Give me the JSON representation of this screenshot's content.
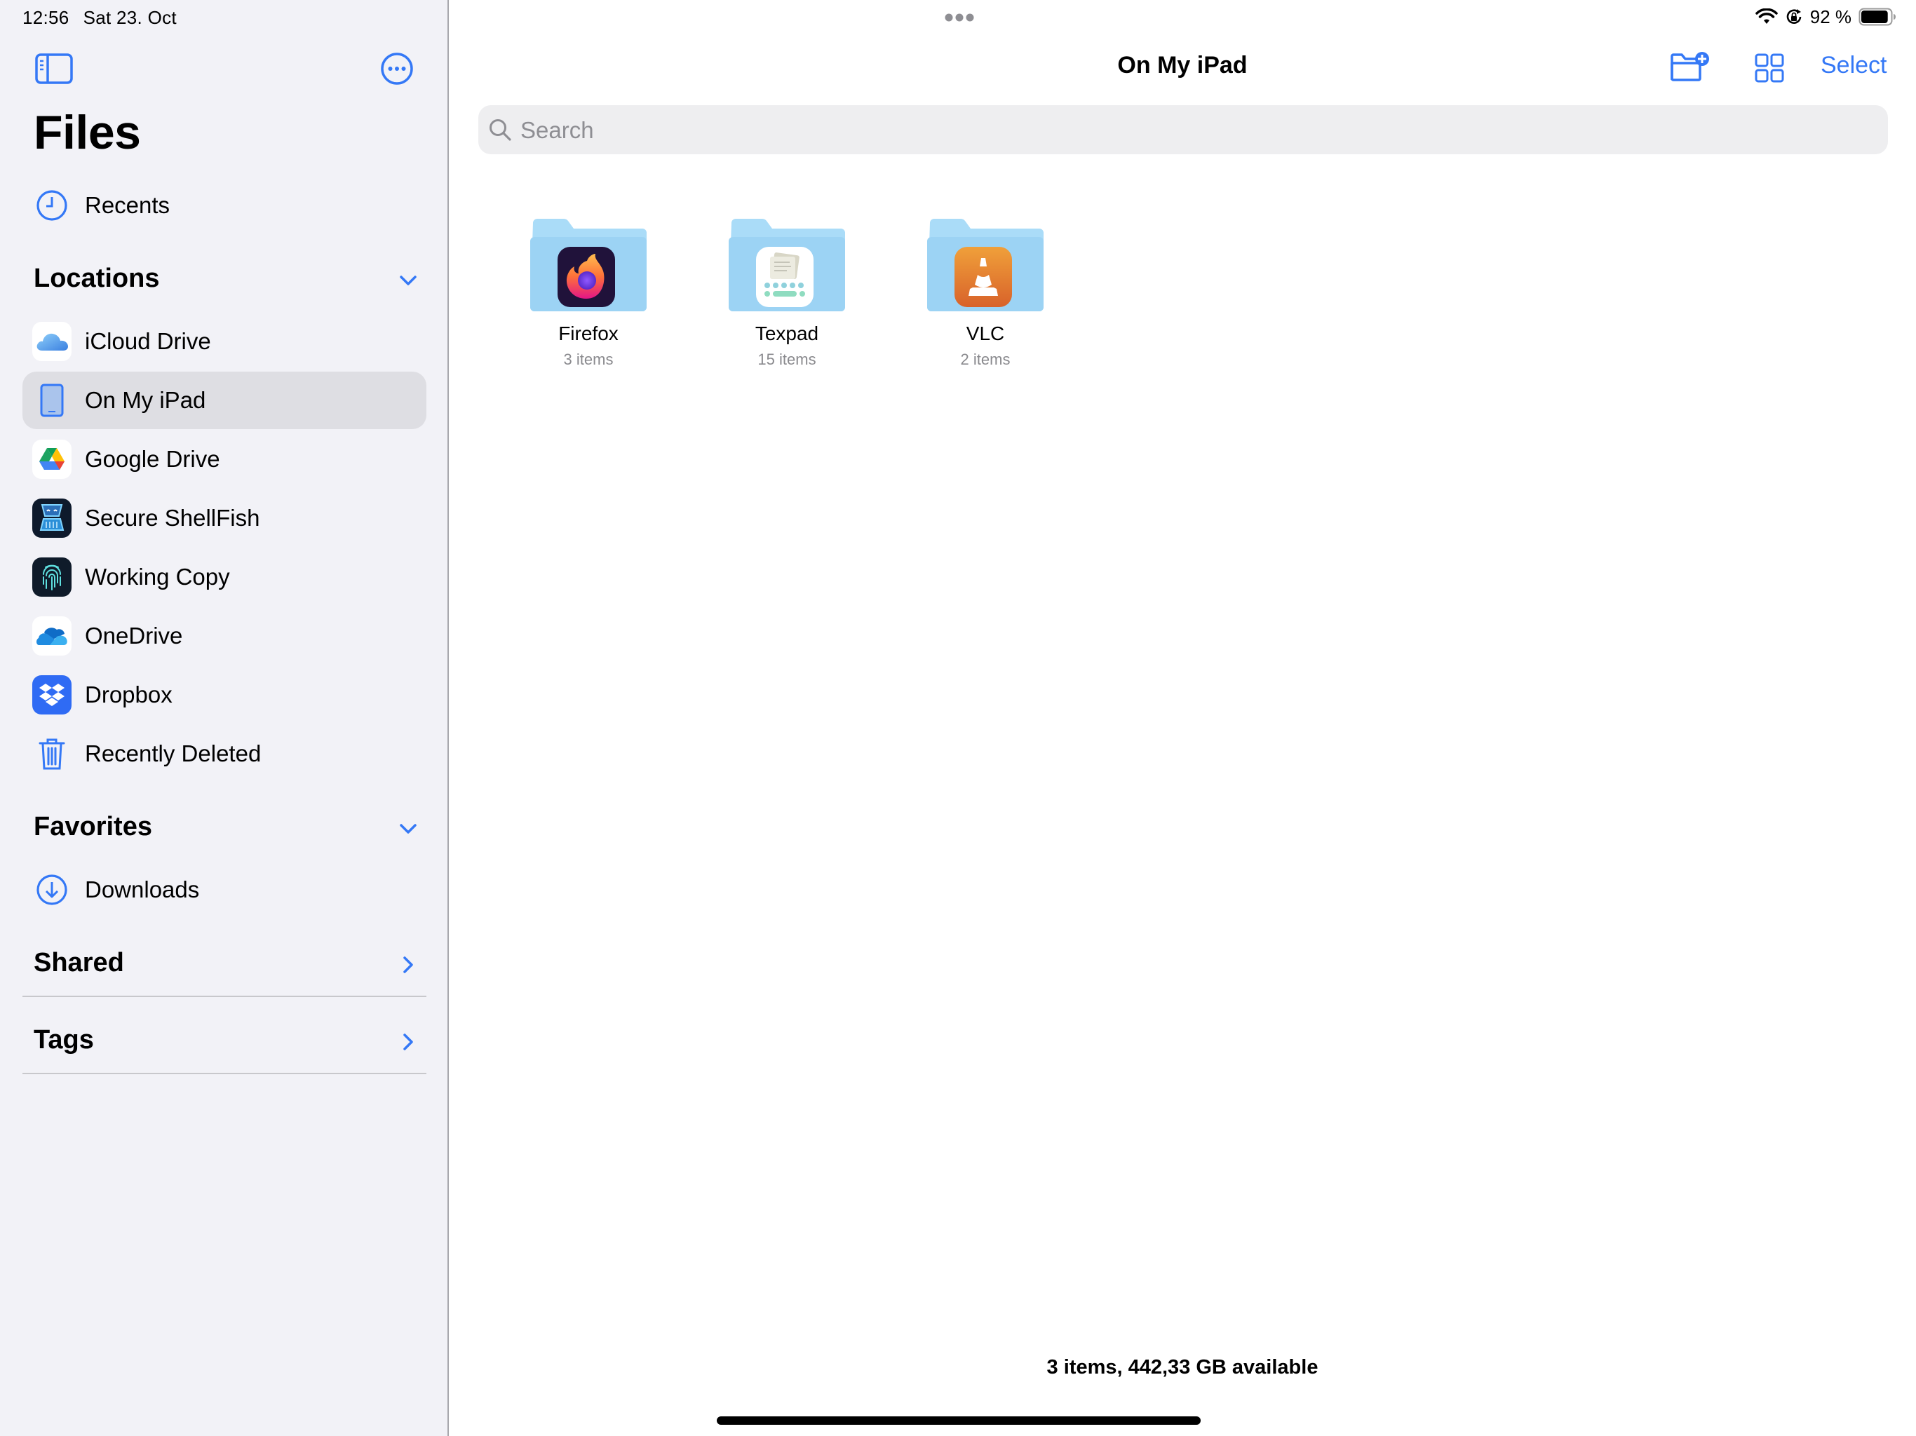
{
  "status_bar": {
    "time": "12:56",
    "date": "Sat 23. Oct",
    "battery_percent": "92 %",
    "battery_level": 0.92,
    "icons": [
      "wifi-icon",
      "orientation-lock-icon",
      "battery-icon"
    ]
  },
  "sidebar": {
    "title": "Files",
    "toggle_icon": "sidebar-toggle-icon",
    "more_icon": "ellipsis-circle-icon",
    "recents": {
      "label": "Recents",
      "icon": "clock-icon"
    },
    "locations": {
      "title": "Locations",
      "expanded": true,
      "items": [
        {
          "label": "iCloud Drive",
          "icon": "icloud-icon",
          "selected": false
        },
        {
          "label": "On My iPad",
          "icon": "ipad-icon",
          "selected": true
        },
        {
          "label": "Google Drive",
          "icon": "google-drive-icon",
          "selected": false
        },
        {
          "label": "Secure ShellFish",
          "icon": "secure-shellfish-icon",
          "selected": false
        },
        {
          "label": "Working Copy",
          "icon": "working-copy-icon",
          "selected": false
        },
        {
          "label": "OneDrive",
          "icon": "onedrive-icon",
          "selected": false
        },
        {
          "label": "Dropbox",
          "icon": "dropbox-icon",
          "selected": false
        },
        {
          "label": "Recently Deleted",
          "icon": "trash-icon",
          "selected": false
        }
      ]
    },
    "favorites": {
      "title": "Favorites",
      "expanded": true,
      "items": [
        {
          "label": "Downloads",
          "icon": "download-circle-icon"
        }
      ]
    },
    "shared": {
      "title": "Shared"
    },
    "tags": {
      "title": "Tags"
    }
  },
  "main": {
    "title": "On My iPad",
    "toolbar": {
      "new_folder_icon": "folder-badge-plus-icon",
      "view_icon": "grid-view-icon",
      "select_label": "Select"
    },
    "search": {
      "placeholder": "Search",
      "value": ""
    },
    "folders": [
      {
        "name": "Firefox",
        "count": "3 items",
        "app_icon": "firefox-icon"
      },
      {
        "name": "Texpad",
        "count": "15 items",
        "app_icon": "texpad-icon"
      },
      {
        "name": "VLC",
        "count": "2 items",
        "app_icon": "vlc-icon"
      }
    ],
    "footer": "3 items, 442,33 GB available"
  },
  "colors": {
    "accent": "#3478f6",
    "sidebar_bg": "#f2f2f7",
    "selected_row": "#dedee3",
    "folder_back": "#aadcf8",
    "folder_front": "#9ed4f5",
    "secondary_text": "#8a8a8e"
  }
}
